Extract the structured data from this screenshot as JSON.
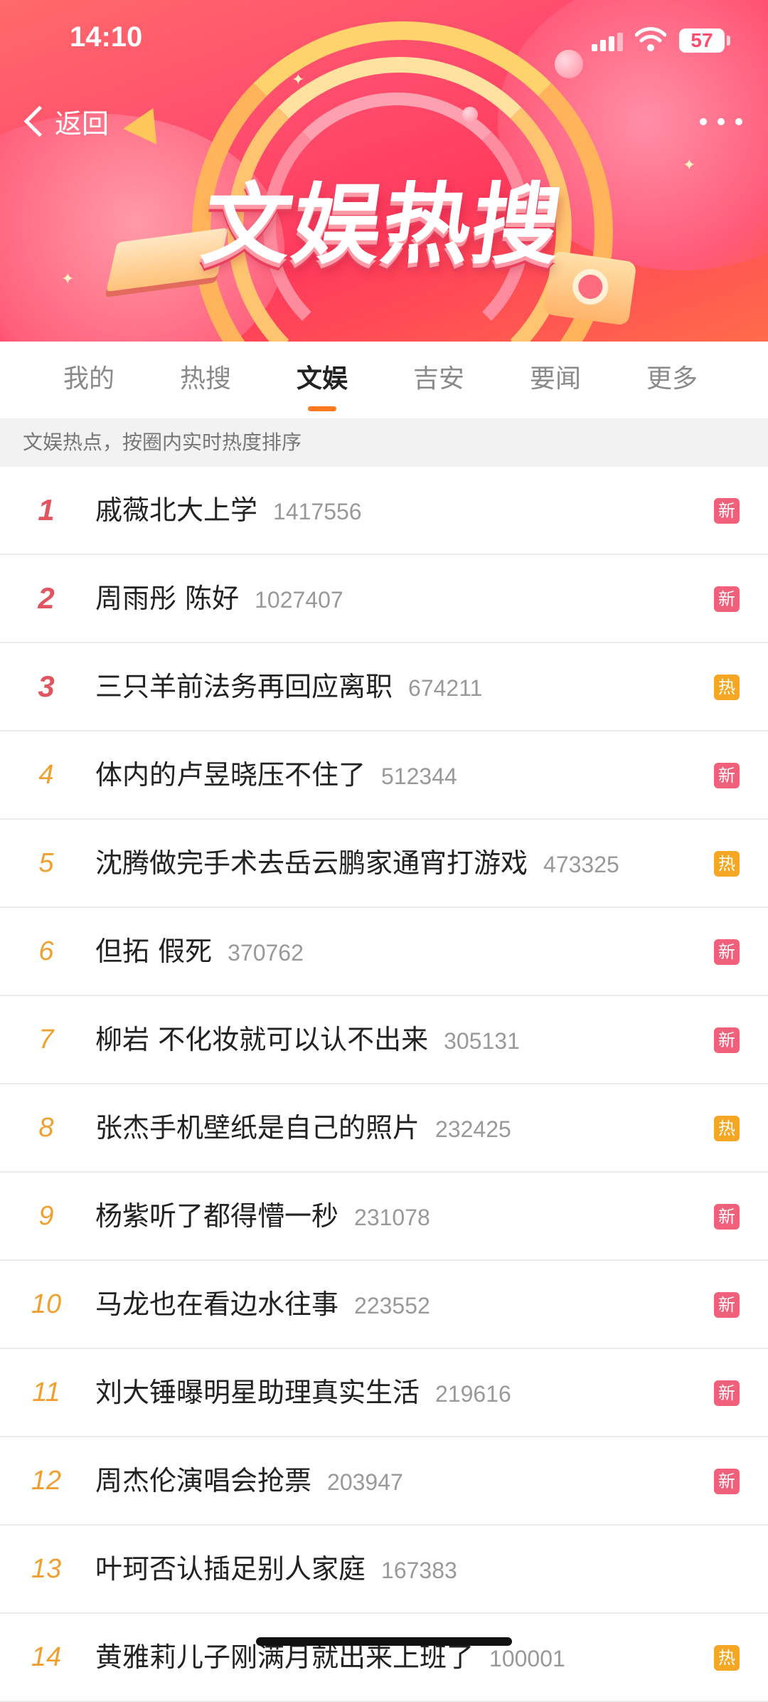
{
  "status_bar": {
    "time": "14:10",
    "battery": "57"
  },
  "header": {
    "back_label": "返回",
    "banner_title": "文娱热搜"
  },
  "tabs": [
    {
      "label": "我的"
    },
    {
      "label": "热搜"
    },
    {
      "label": "文娱",
      "active": true
    },
    {
      "label": "吉安"
    },
    {
      "label": "要闻"
    },
    {
      "label": "更多"
    }
  ],
  "subtitle": "文娱热点，按圈内实时热度排序",
  "badge_colors": {
    "new": "#f0607a",
    "hot": "#f5a623"
  },
  "items": [
    {
      "rank": "1",
      "title": "戚薇北大上学",
      "count": "1417556",
      "badge": "新",
      "badge_type": "new"
    },
    {
      "rank": "2",
      "title": "周雨彤 陈好",
      "count": "1027407",
      "badge": "新",
      "badge_type": "new"
    },
    {
      "rank": "3",
      "title": "三只羊前法务再回应离职",
      "count": "674211",
      "badge": "热",
      "badge_type": "hot"
    },
    {
      "rank": "4",
      "title": "体内的卢昱晓压不住了",
      "count": "512344",
      "badge": "新",
      "badge_type": "new"
    },
    {
      "rank": "5",
      "title": "沈腾做完手术去岳云鹏家通宵打游戏",
      "count": "473325",
      "badge": "热",
      "badge_type": "hot"
    },
    {
      "rank": "6",
      "title": "但拓 假死",
      "count": "370762",
      "badge": "新",
      "badge_type": "new"
    },
    {
      "rank": "7",
      "title": "柳岩 不化妆就可以认不出来",
      "count": "305131",
      "badge": "新",
      "badge_type": "new"
    },
    {
      "rank": "8",
      "title": "张杰手机壁纸是自己的照片",
      "count": "232425",
      "badge": "热",
      "badge_type": "hot"
    },
    {
      "rank": "9",
      "title": "杨紫听了都得懵一秒",
      "count": "231078",
      "badge": "新",
      "badge_type": "new"
    },
    {
      "rank": "10",
      "title": "马龙也在看边水往事",
      "count": "223552",
      "badge": "新",
      "badge_type": "new"
    },
    {
      "rank": "11",
      "title": "刘大锤曝明星助理真实生活",
      "count": "219616",
      "badge": "新",
      "badge_type": "new"
    },
    {
      "rank": "12",
      "title": "周杰伦演唱会抢票",
      "count": "203947",
      "badge": "新",
      "badge_type": "new"
    },
    {
      "rank": "13",
      "title": "叶珂否认插足别人家庭",
      "count": "167383",
      "badge": "",
      "badge_type": ""
    },
    {
      "rank": "14",
      "title": "黄雅莉儿子刚满月就出来上班了",
      "count": "100001",
      "badge": "热",
      "badge_type": "hot"
    }
  ]
}
